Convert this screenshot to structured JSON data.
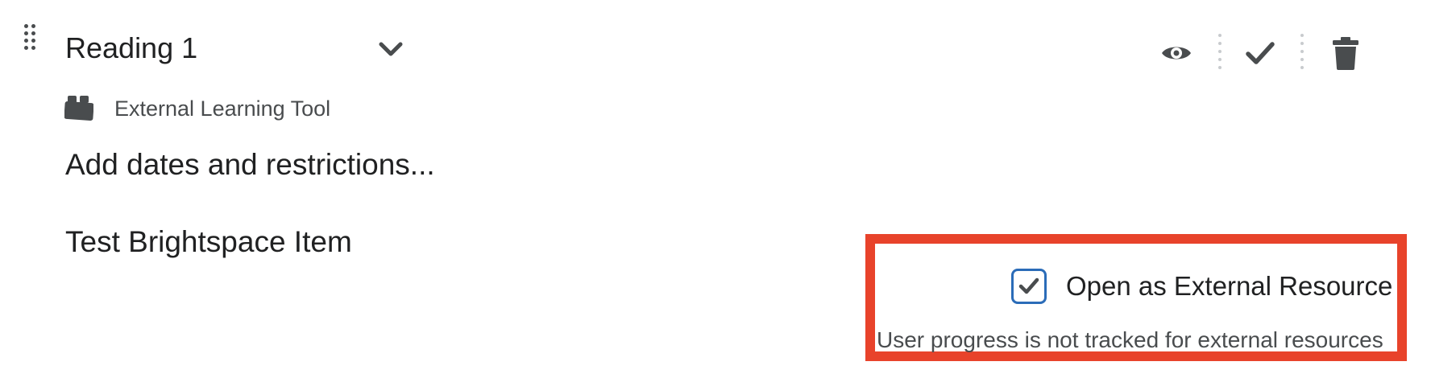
{
  "item": {
    "title": "Reading 1",
    "tool_type": "External Learning Tool",
    "dates_link": "Add dates and restrictions...",
    "description": "Test Brightspace Item"
  },
  "icons": {
    "drag": "drag-handle-icon",
    "expand": "chevron-down-icon",
    "tool": "lego-brick-icon",
    "visibility": "eye-icon",
    "completion": "checkmark-icon",
    "delete": "trash-icon"
  },
  "external_resource": {
    "checked": true,
    "label": "Open as External Resource",
    "note": "User progress is not tracked for external resources"
  },
  "colors": {
    "highlight": "#e8432b",
    "checkbox_border": "#2b6cb8",
    "icon": "#494c4e"
  }
}
